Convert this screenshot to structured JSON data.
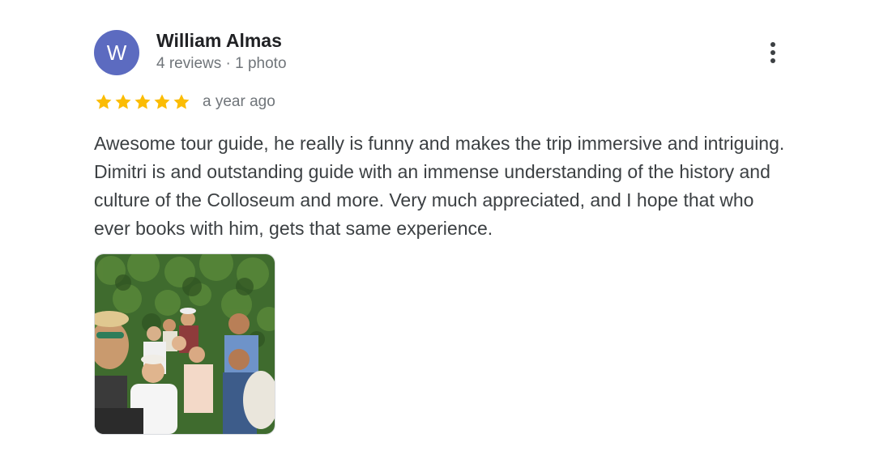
{
  "author": {
    "initial": "W",
    "name": "William Almas",
    "meta": "4 reviews · 1 photo",
    "avatar_color": "#5c6bc0"
  },
  "rating": {
    "stars": 5,
    "max_stars": 5,
    "star_color": "#fbbc04",
    "time_ago": "a year ago"
  },
  "review": {
    "text": "Awesome tour guide, he really is funny and makes the trip immersive and intriguing. Dimitri is and outstanding guide with an immense understanding of the history and culture of the Colloseum and more. Very much appreciated, and I hope that who ever books with him, gets that same experience."
  },
  "icons": {
    "more": "more-vert-icon",
    "star": "star-icon"
  },
  "photos": [
    {
      "description_icon": "group-photo"
    }
  ]
}
